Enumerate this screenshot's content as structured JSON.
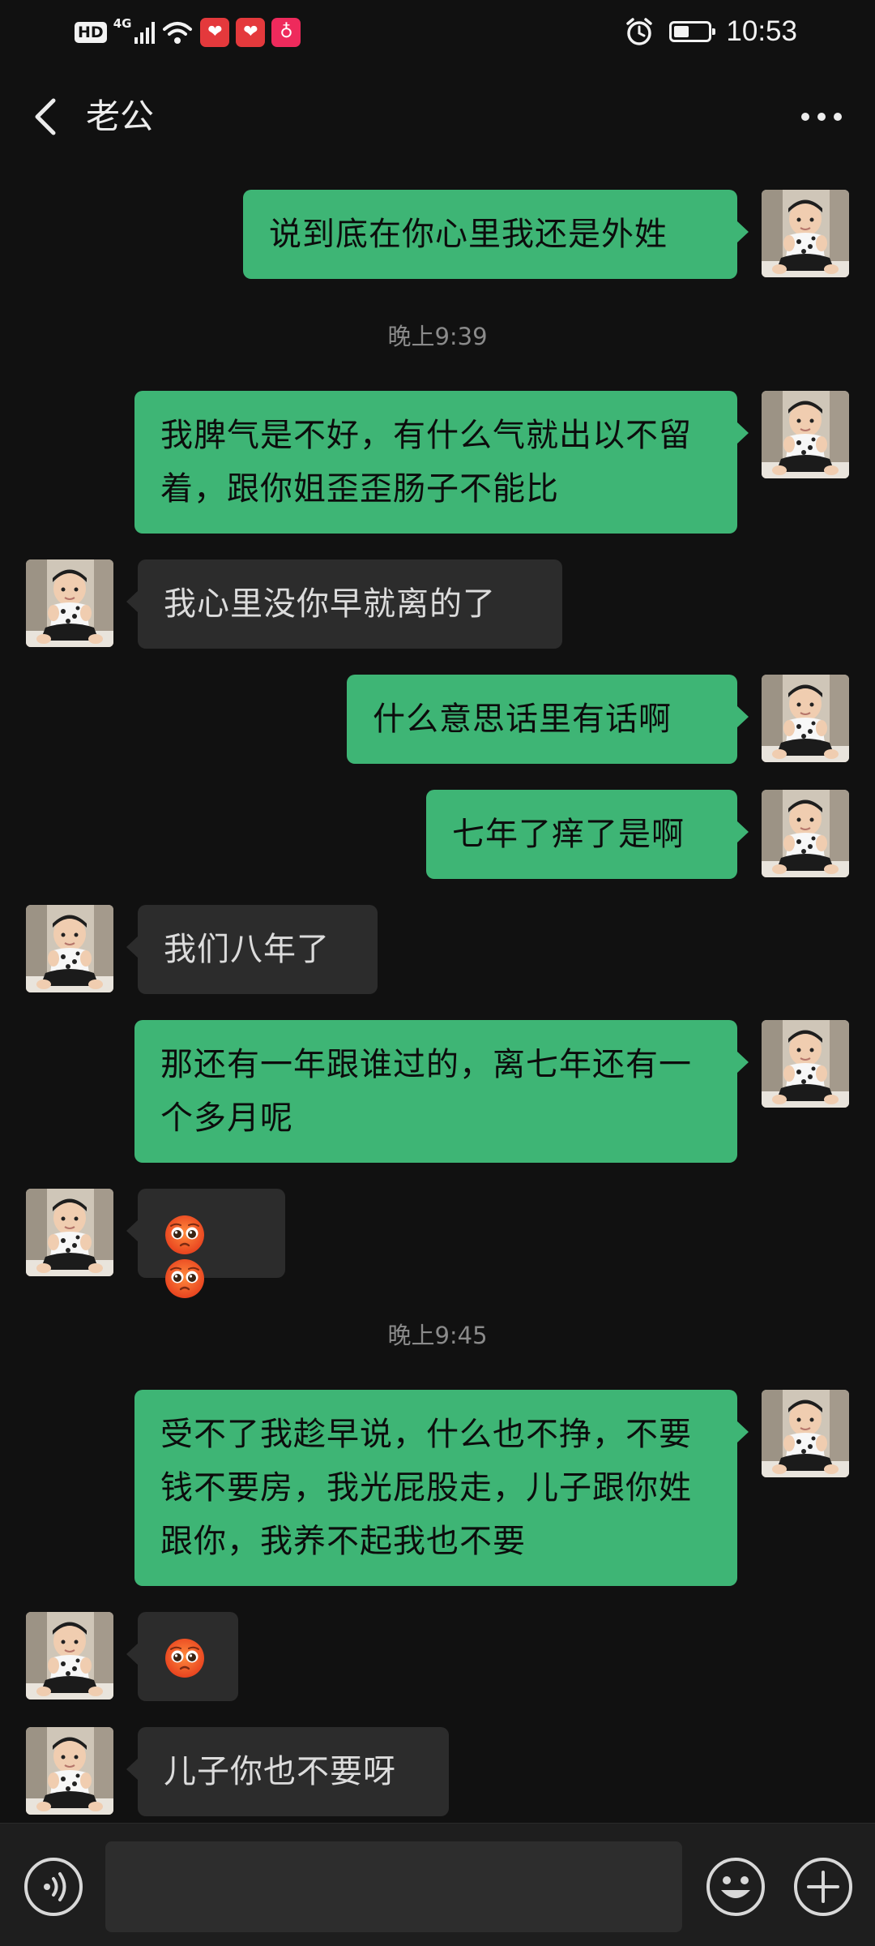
{
  "status_bar": {
    "hd": "HD",
    "network": "4G",
    "time": "10:53",
    "battery_level": 0.45
  },
  "header": {
    "title": "老公",
    "back_icon": "chevron-left-icon",
    "more_icon": "more-dots-icon"
  },
  "messages": [
    {
      "side": "out",
      "text": "说到底在你心里我还是外姓"
    },
    {
      "type": "time",
      "text": "晚上9:39"
    },
    {
      "side": "out",
      "text": "我脾气是不好，有什么气就出以不留着，跟你姐歪歪肠子不能比"
    },
    {
      "side": "in",
      "text": "我心里没你早就离的了"
    },
    {
      "side": "out",
      "text": "什么意思话里有话啊"
    },
    {
      "side": "out",
      "text": "七年了痒了是啊"
    },
    {
      "side": "in",
      "text": "我们八年了"
    },
    {
      "side": "out",
      "text": "那还有一年跟谁过的，离七年还有一个多月呢"
    },
    {
      "side": "in",
      "emoji": "pleading-face-emoji",
      "count": 2
    },
    {
      "type": "time",
      "text": "晚上9:45"
    },
    {
      "side": "out",
      "text": "受不了我趁早说，什么也不挣，不要钱不要房，我光屁股走，儿子跟你姓跟你，我养不起我也不要"
    },
    {
      "side": "in",
      "emoji": "pleading-face-emoji",
      "count": 1
    },
    {
      "side": "in",
      "text": "儿子你也不要呀"
    }
  ],
  "input_bar": {
    "voice_icon": "voice-icon",
    "input_value": "",
    "emoji_icon": "emoji-icon",
    "plus_icon": "plus-icon"
  },
  "colors": {
    "background": "#111111",
    "outgoing_bubble": "#3eb575",
    "incoming_bubble": "#2c2c2c",
    "timestamp": "#8a8a8a"
  }
}
